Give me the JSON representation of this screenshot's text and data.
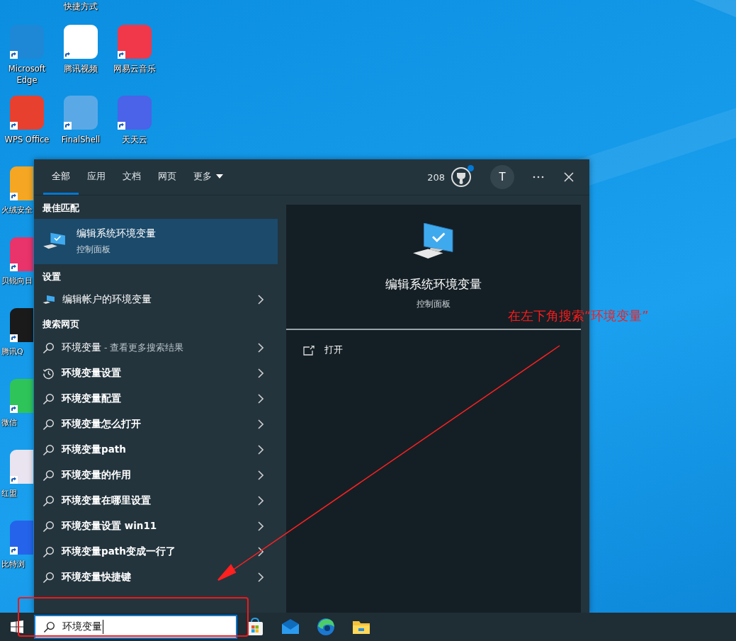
{
  "desktop": {
    "columns": [
      {
        "icons": [
          {
            "label": "Microsoft Edge",
            "color": "#1e88d6",
            "kind": "full"
          },
          {
            "label": "WPS Office",
            "color": "#e8402e",
            "kind": "full"
          },
          {
            "label": "火绒安全",
            "color": "#f5a623",
            "kind": "partial"
          },
          {
            "label": "贝锐向日",
            "color": "#e8336b",
            "kind": "partial"
          },
          {
            "label": "腾讯Q",
            "color": "#1a1a1a",
            "kind": "partial"
          },
          {
            "label": "微信",
            "color": "#2ec45a",
            "kind": "partial"
          },
          {
            "label": "红盟",
            "color": "#e9e4ef",
            "kind": "partial"
          },
          {
            "label": "比特浏",
            "color": "#2563eb",
            "kind": "partial"
          }
        ]
      },
      {
        "icons": [
          {
            "label": "快捷方式",
            "kind": "cut"
          },
          {
            "label": "腾讯视频",
            "color": "#ffffff",
            "kind": "full"
          },
          {
            "label": "FinalShell",
            "color": "#5aa9e6",
            "kind": "full"
          }
        ]
      },
      {
        "icons": [
          {
            "label": "网易云音乐",
            "color": "#f0384a",
            "kind": "full"
          },
          {
            "label": "天天云",
            "color": "#4a63e8",
            "kind": "full"
          }
        ]
      }
    ]
  },
  "search_panel": {
    "tabs": [
      {
        "label": "全部",
        "selected": true,
        "kind": "tab"
      },
      {
        "label": "应用",
        "selected": false,
        "kind": "tab"
      },
      {
        "label": "文档",
        "selected": false,
        "kind": "tab"
      },
      {
        "label": "网页",
        "selected": false,
        "kind": "tab"
      },
      {
        "label": "更多",
        "selected": false,
        "kind": "menu"
      }
    ],
    "points": "208",
    "rewards_notification": true,
    "avatar": "T",
    "best_match": {
      "heading": "最佳匹配",
      "title": "编辑系统环境变量",
      "subtitle": "控制面板",
      "selected": true
    },
    "settings": {
      "heading": "设置",
      "items": [
        {
          "label": "编辑帐户的环境变量"
        }
      ]
    },
    "web": {
      "heading": "搜索网页",
      "items": [
        {
          "label": "环境变量",
          "hint": " - 查看更多搜索结果",
          "kind": "search"
        },
        {
          "label": "环境变量设置",
          "kind": "history"
        },
        {
          "label": "环境变量配置",
          "kind": "search"
        },
        {
          "label": "环境变量怎么打开",
          "kind": "search"
        },
        {
          "label": "环境变量path",
          "kind": "search"
        },
        {
          "label": "环境变量的作用",
          "kind": "search"
        },
        {
          "label": "环境变量在哪里设置",
          "kind": "search"
        },
        {
          "label": "环境变量设置 win11",
          "kind": "search"
        },
        {
          "label": "环境变量path变成一行了",
          "kind": "search"
        },
        {
          "label": "环境变量快捷键",
          "kind": "search"
        }
      ]
    },
    "preview": {
      "title": "编辑系统环境变量",
      "subtitle": "控制面板",
      "actions": [
        {
          "label": "打开"
        }
      ]
    }
  },
  "taskbar": {
    "search_value": "环境变量"
  },
  "annotation": {
    "text": "在左下角搜索“环境变量”"
  }
}
